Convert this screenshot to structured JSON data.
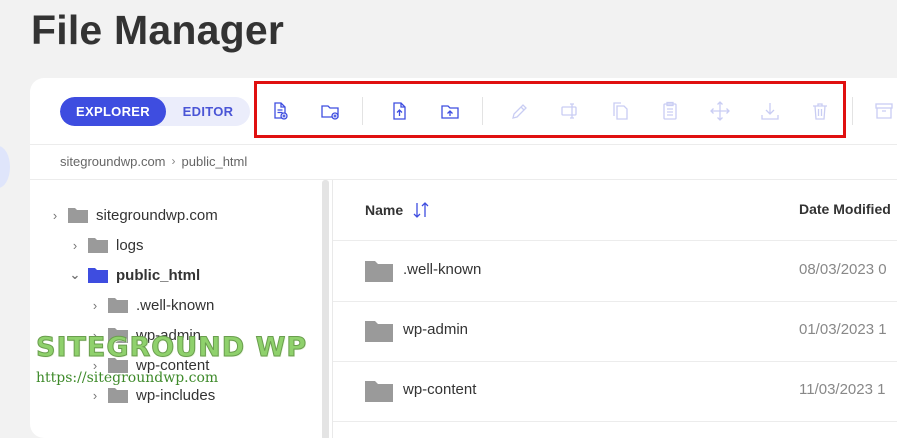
{
  "page": {
    "title": "File Manager"
  },
  "view_toggle": {
    "explorer_label": "EXPLORER",
    "editor_label": "EDITOR"
  },
  "toolbar": {
    "tools": [
      {
        "name": "new-file-icon",
        "enabled": true
      },
      {
        "name": "new-folder-icon",
        "enabled": true
      },
      {
        "name": "upload-file-icon",
        "enabled": true
      },
      {
        "name": "upload-folder-icon",
        "enabled": true
      },
      {
        "name": "rename-icon",
        "enabled": false
      },
      {
        "name": "edit-icon",
        "enabled": false
      },
      {
        "name": "copy-icon",
        "enabled": false
      },
      {
        "name": "paste-icon",
        "enabled": false
      },
      {
        "name": "move-icon",
        "enabled": false
      },
      {
        "name": "download-icon",
        "enabled": false
      },
      {
        "name": "delete-icon",
        "enabled": false
      },
      {
        "name": "archive-icon",
        "enabled": false
      }
    ]
  },
  "breadcrumb": {
    "root": "sitegroundwp.com",
    "current": "public_html"
  },
  "tree": {
    "items": [
      {
        "label": "sitegroundwp.com",
        "expanded": false,
        "selected": false
      },
      {
        "label": "logs",
        "expanded": false,
        "selected": false
      },
      {
        "label": "public_html",
        "expanded": true,
        "selected": true
      },
      {
        "label": ".well-known",
        "expanded": false,
        "selected": false
      },
      {
        "label": "wp-admin",
        "expanded": false,
        "selected": false
      },
      {
        "label": "wp-content",
        "expanded": false,
        "selected": false
      },
      {
        "label": "wp-includes",
        "expanded": false,
        "selected": false
      }
    ]
  },
  "list": {
    "columns": {
      "name": "Name",
      "date": "Date Modified"
    },
    "rows": [
      {
        "name": ".well-known",
        "date": "08/03/2023 0"
      },
      {
        "name": "wp-admin",
        "date": "01/03/2023 1"
      },
      {
        "name": "wp-content",
        "date": "11/03/2023 1"
      }
    ]
  },
  "watermark": {
    "title": "SITEGROUND WP",
    "url": "https://sitegroundwp.com"
  },
  "colors": {
    "accent": "#3e4de0",
    "highlight": "#e01010",
    "folder": "#9a9a9a",
    "folder_selected": "#3e4de0",
    "disabled_icon": "#c9cdf3"
  }
}
